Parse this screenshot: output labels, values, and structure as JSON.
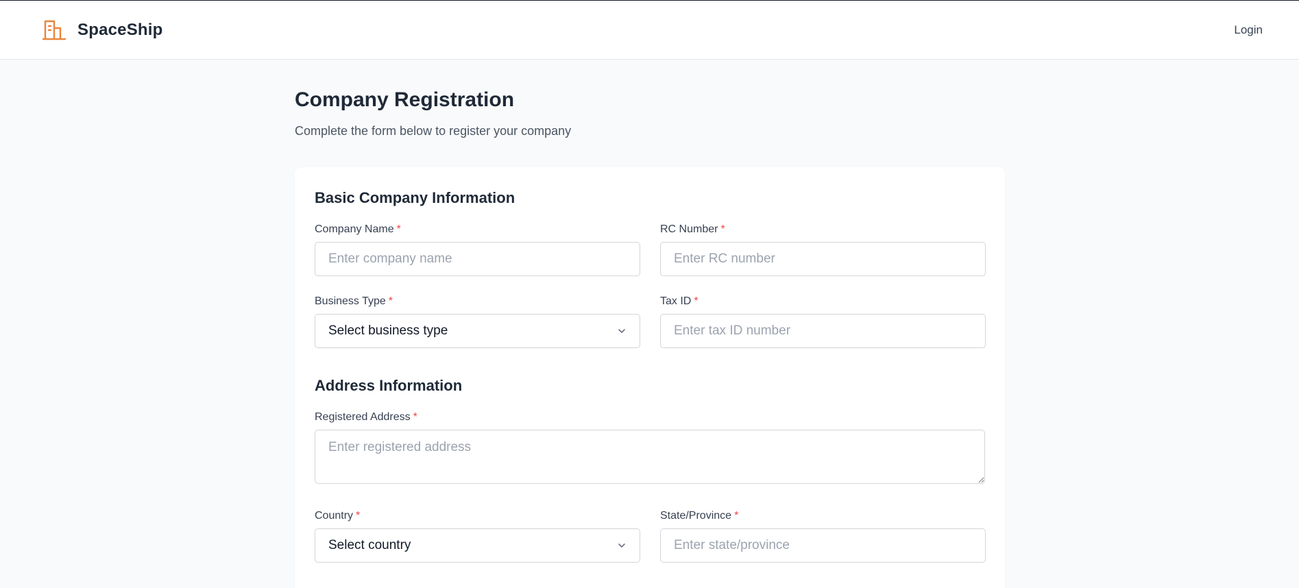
{
  "header": {
    "brand_name": "SpaceShip",
    "brand_icon": "building-icon",
    "brand_color": "#e8863a",
    "login_label": "Login"
  },
  "page": {
    "title": "Company Registration",
    "subtitle": "Complete the form below to register your company"
  },
  "sections": {
    "basic": {
      "title": "Basic Company Information",
      "company_name": {
        "label": "Company Name",
        "required": "*",
        "placeholder": "Enter company name",
        "value": ""
      },
      "rc_number": {
        "label": "RC Number",
        "required": "*",
        "placeholder": "Enter RC number",
        "value": ""
      },
      "business_type": {
        "label": "Business Type",
        "required": "*",
        "selected": "Select business type"
      },
      "tax_id": {
        "label": "Tax ID",
        "required": "*",
        "placeholder": "Enter tax ID number",
        "value": ""
      }
    },
    "address": {
      "title": "Address Information",
      "registered_address": {
        "label": "Registered Address",
        "required": "*",
        "placeholder": "Enter registered address",
        "value": ""
      },
      "country": {
        "label": "Country",
        "required": "*",
        "selected": "Select country"
      },
      "state": {
        "label": "State/Province",
        "required": "*",
        "placeholder": "Enter state/province",
        "value": ""
      }
    }
  },
  "colors": {
    "required": "#ef4444",
    "background": "#f9fafb",
    "border": "#d1d5db"
  }
}
